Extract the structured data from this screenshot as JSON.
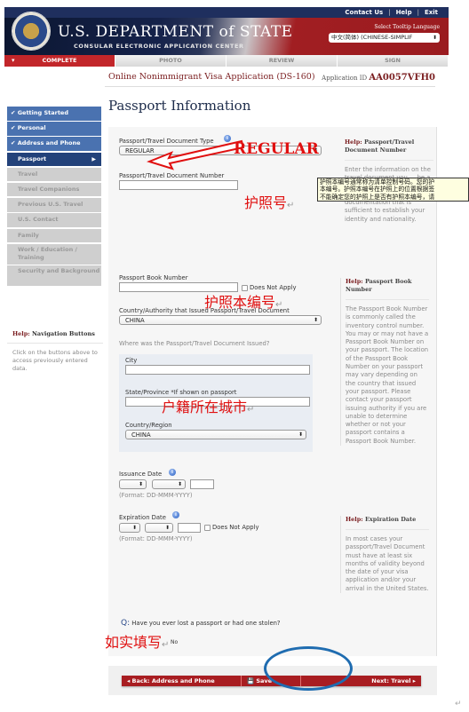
{
  "header": {
    "title": "U.S. DEPARTMENT of STATE",
    "subtitle": "CONSULAR ELECTRONIC APPLICATION CENTER",
    "links": [
      "Contact Us",
      "Help",
      "Exit"
    ],
    "language_label": "Select Tooltip Language",
    "language_value": "中文(简体) (CHINESE-SIMPLIF"
  },
  "progress_tabs": [
    {
      "label": "COMPLETE",
      "active": true
    },
    {
      "label": "PHOTO",
      "active": false
    },
    {
      "label": "REVIEW",
      "active": false
    },
    {
      "label": "SIGN",
      "active": false
    }
  ],
  "app": {
    "title": "Online Nonimmigrant Visa Application (DS-160)",
    "id_label": "Application ID",
    "id_value": "AA0057VFH0"
  },
  "page_title": "Passport Information",
  "sidebar": {
    "items": [
      {
        "label": "✔ Getting Started",
        "state": "done"
      },
      {
        "label": "✔ Personal",
        "state": "done"
      },
      {
        "label": "✔ Address and Phone",
        "state": "done"
      },
      {
        "label": "Passport",
        "state": "current"
      },
      {
        "label": "Travel",
        "state": "todo"
      },
      {
        "label": "Travel Companions",
        "state": "todo"
      },
      {
        "label": "Previous U.S. Travel",
        "state": "todo"
      },
      {
        "label": "U.S. Contact",
        "state": "todo"
      },
      {
        "label": "Family",
        "state": "todo"
      },
      {
        "label": "Work / Education / Training",
        "state": "todo"
      },
      {
        "label": "Security and Background",
        "state": "todo"
      }
    ],
    "help_prefix": "Help:",
    "help_title": "Navigation Buttons",
    "help_text": "Click on the buttons above to access previously entered data."
  },
  "form": {
    "doc_type_label": "Passport/Travel Document Type",
    "doc_type_value": "REGULAR",
    "doc_number_label": "Passport/Travel Document Number",
    "doc_number_value": "",
    "book_number_label": "Passport Book Number",
    "book_number_value": "",
    "does_not_apply": "Does Not Apply",
    "country_label": "Country/Authority that Issued Passport/Travel Document",
    "country_value": "CHINA",
    "where_issued_label": "Where was the Passport/Travel Document Issued?",
    "city_label": "City",
    "city_value": "",
    "state_label": "State/Province *If shown on passport",
    "state_value": "",
    "region_label": "Country/Region",
    "region_value": "CHINA",
    "issuance_label": "Issuance Date",
    "expiration_label": "Expiration Date",
    "date_format": "(Format: DD-MMM-YYYY)",
    "lost_q_prefix": "Q:",
    "lost_question": "Have you ever lost a passport or had one stolen?",
    "lost_answer_no": "No"
  },
  "help_panels": [
    {
      "prefix": "Help:",
      "title": "Passport/Travel Document Number",
      "text": "Enter the information on the travel document you ... be a valid, unexpired passport or other valid, unexpired documentation that is sufficient to establish your identity and nationality."
    },
    {
      "prefix": "Help:",
      "title": "Passport Book Number",
      "text": "The Passport Book Number is commonly called the inventory control number. You may or may not have a Passport Book Number on your passport. The location of the Passport Book Number on your passport may vary depending on the country that issued your passport. Please contact your passport issuing authority if you are unable to determine whether or not your passport contains a Passport Book Number."
    },
    {
      "prefix": "Help:",
      "title": "Expiration Date",
      "text": "In most cases your passport/Travel Document must have at least six months of validity beyond the date of your visa application and/or your arrival in the United States."
    }
  ],
  "tooltip": {
    "lines": [
      "护照本编号通常称为清单控制号码。您的护",
      "本编号。护照本编号在护照上的位置根据签",
      "不能确定您的护照上是否有护照本编号，请"
    ]
  },
  "nav_buttons": {
    "back": "◂ Back: Address and Phone",
    "save": "Save",
    "next": "Next: Travel ▸"
  },
  "annotations": {
    "regular": "REGULAR",
    "passport_no": "护照号",
    "book_no": "护照本编号",
    "city": "户籍所在城市",
    "truthful": "如实填写",
    "return_mark": "↵"
  }
}
